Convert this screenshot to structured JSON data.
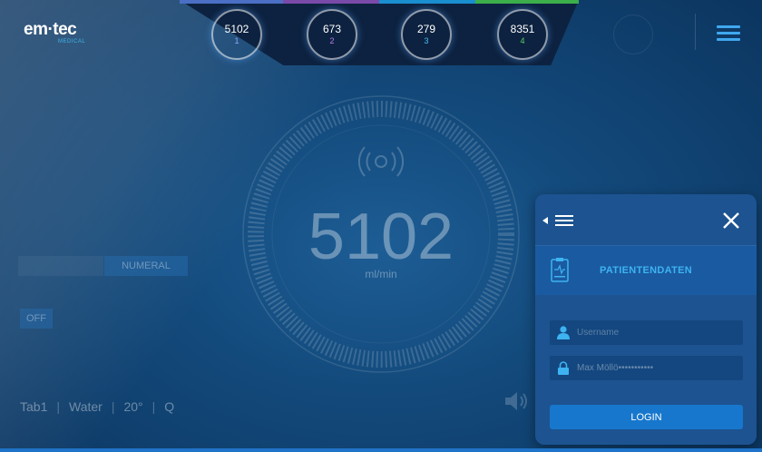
{
  "logo": {
    "main": "em·tec",
    "sub": "MEDICAL"
  },
  "channels": [
    {
      "value": "5102",
      "number": "1",
      "accent": "#4a6fc4",
      "numcolor": "#8fa6ff"
    },
    {
      "value": "673",
      "number": "2",
      "accent": "#7a4aa8",
      "numcolor": "#b57ef0"
    },
    {
      "value": "279",
      "number": "3",
      "accent": "#1a8fd0",
      "numcolor": "#42c0f8"
    },
    {
      "value": "8351",
      "number": "4",
      "accent": "#3cae4a",
      "numcolor": "#56d066"
    }
  ],
  "menu_icon": "hamburger-icon",
  "main_reading": {
    "value": "5102",
    "unit": "ml/min"
  },
  "left_controls": {
    "numeral": "NUMERAL",
    "off": "OFF"
  },
  "settings": {
    "tab": "Tab1",
    "medium": "Water",
    "temp": "20°",
    "q": "Q"
  },
  "panel": {
    "section_label": "PATIENTENDATEN",
    "username_placeholder": "Username",
    "password_value": "Max Möllö•••••••••••",
    "login_label": "LOGIN"
  },
  "colors": {
    "background": "#134a7c",
    "panel": "#1c5390",
    "login": "#1777cc",
    "accent_text": "#3db3f2"
  }
}
